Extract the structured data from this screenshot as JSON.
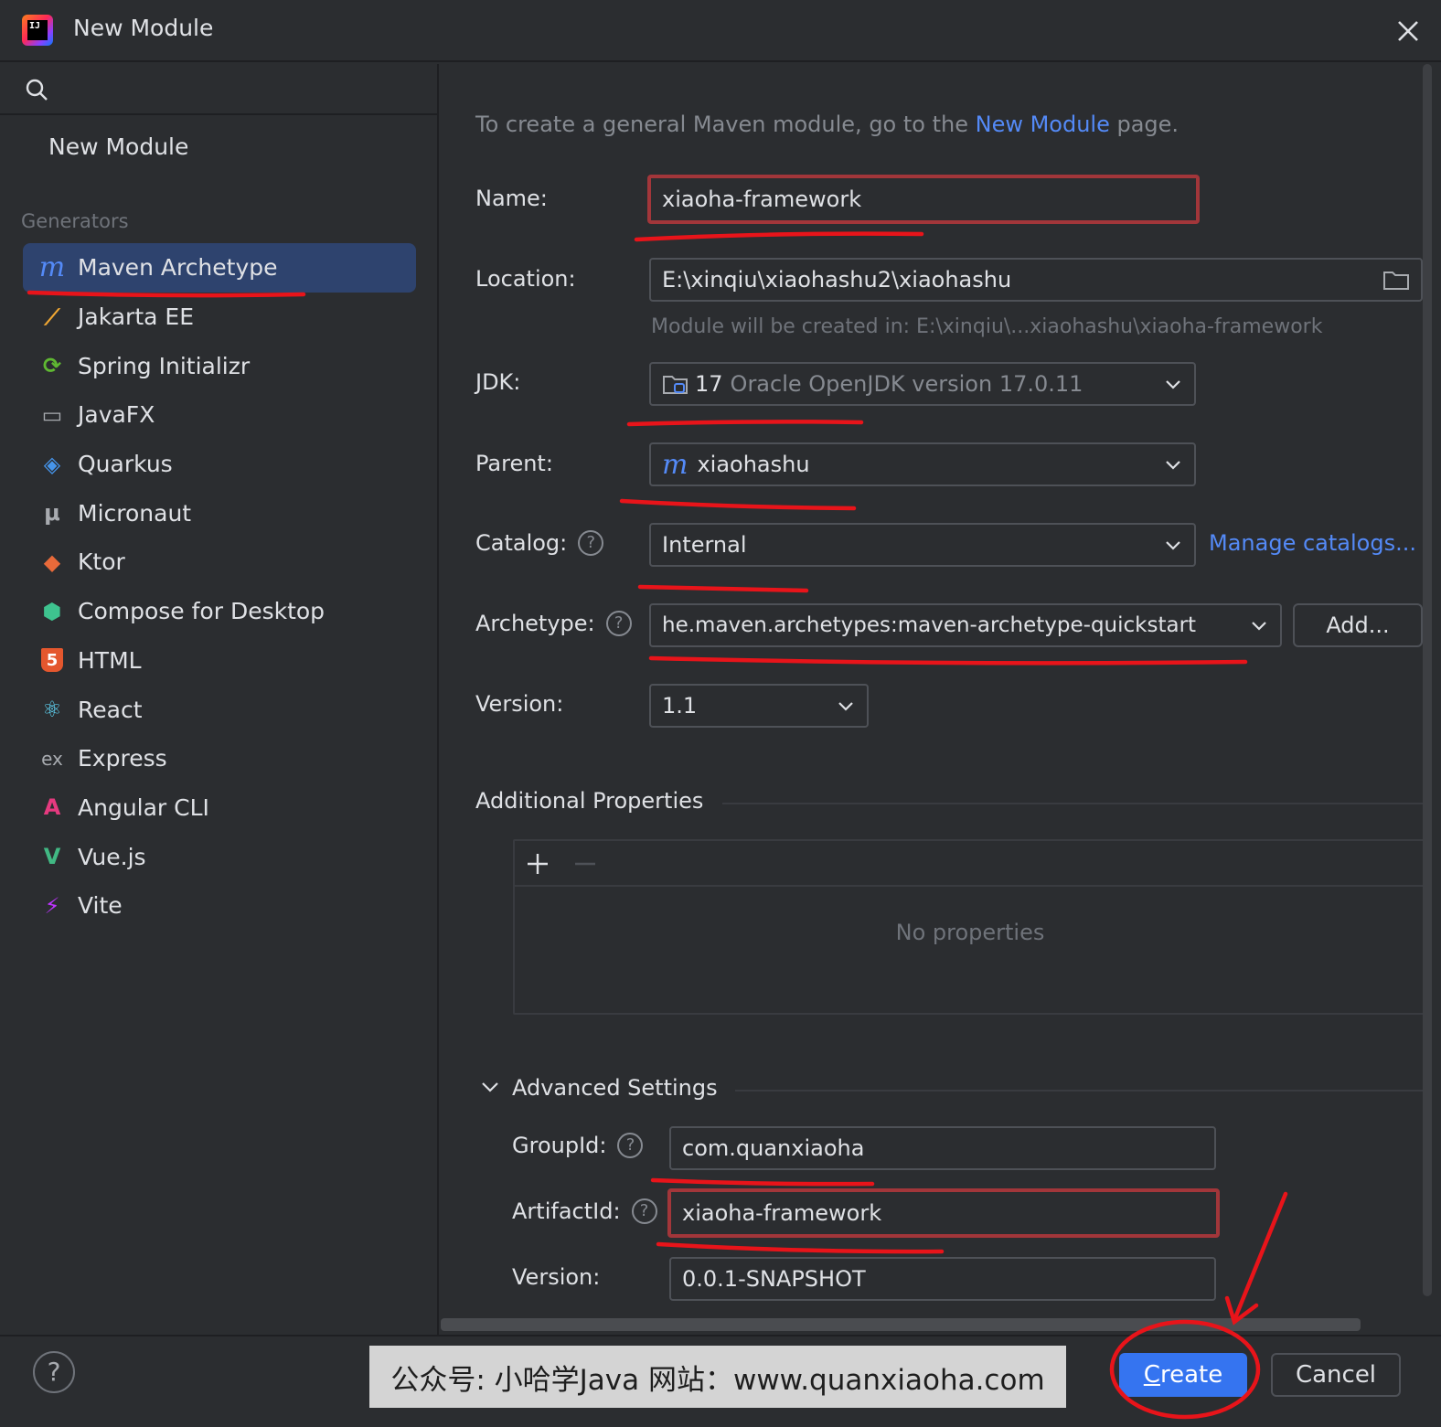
{
  "window": {
    "title": "New Module",
    "app_icon_text": "IJ"
  },
  "sidebar": {
    "new_module": "New Module",
    "generators_label": "Generators",
    "items": [
      {
        "label": "Maven Archetype",
        "icon": "maven-icon",
        "glyph": "m",
        "color": "#548af7",
        "selected": true
      },
      {
        "label": "Jakarta EE",
        "icon": "jakarta-ee-icon",
        "glyph": "⟋",
        "color": "#f0a733"
      },
      {
        "label": "Spring Initializr",
        "icon": "spring-icon",
        "glyph": "⟳",
        "color": "#5fb832"
      },
      {
        "label": "JavaFX",
        "icon": "javafx-icon",
        "glyph": "▭",
        "color": "#a8abb0"
      },
      {
        "label": "Quarkus",
        "icon": "quarkus-icon",
        "glyph": "◈",
        "color": "#4695eb"
      },
      {
        "label": "Micronaut",
        "icon": "micronaut-icon",
        "glyph": "μ",
        "color": "#a8abb0"
      },
      {
        "label": "Ktor",
        "icon": "ktor-icon",
        "glyph": "◆",
        "color": "#e86a3a"
      },
      {
        "label": "Compose for Desktop",
        "icon": "compose-icon",
        "glyph": "⬢",
        "color": "#3ec38f"
      },
      {
        "label": "HTML",
        "icon": "html-icon",
        "glyph": "5",
        "color": "#e4572e"
      },
      {
        "label": "React",
        "icon": "react-icon",
        "glyph": "⚛",
        "color": "#61dafb"
      },
      {
        "label": "Express",
        "icon": "express-icon",
        "glyph": "ex",
        "color": "#a8abb0"
      },
      {
        "label": "Angular CLI",
        "icon": "angular-icon",
        "glyph": "A",
        "color": "#e53a7f"
      },
      {
        "label": "Vue.js",
        "icon": "vue-icon",
        "glyph": "V",
        "color": "#41b883"
      },
      {
        "label": "Vite",
        "icon": "vite-icon",
        "glyph": "⚡",
        "color": "#bd34fe"
      }
    ]
  },
  "main": {
    "hint_prefix": "To create a general Maven module, go to the ",
    "hint_link": "New Module",
    "hint_suffix": " page.",
    "name_label": "Name:",
    "name_value": "xiaoha-framework",
    "location_label": "Location:",
    "location_value": "E:\\xinqiu\\xiaohashu2\\xiaohashu",
    "location_hint": "Module will be created in: E:\\xinqiu\\...xiaohashu\\xiaoha-framework",
    "jdk_label": "JDK:",
    "jdk_version": "17",
    "jdk_desc": "Oracle OpenJDK version 17.0.11",
    "parent_label": "Parent:",
    "parent_value": "xiaohashu",
    "catalog_label": "Catalog:",
    "catalog_value": "Internal",
    "manage_catalogs": "Manage catalogs...",
    "archetype_label": "Archetype:",
    "archetype_value": "he.maven.archetypes:maven-archetype-quickstart",
    "add_button": "Add...",
    "version_label": "Version:",
    "version_value": "1.1",
    "additional_properties": "Additional Properties",
    "no_properties": "No properties",
    "advanced_settings": "Advanced Settings",
    "groupid_label": "GroupId:",
    "groupid_value": "com.quanxiaoha",
    "artifactid_label": "ArtifactId:",
    "artifactid_value": "xiaoha-framework",
    "adv_version_label": "Version:",
    "adv_version_value": "0.0.1-SNAPSHOT"
  },
  "footer": {
    "help": "?",
    "watermark": "公众号: 小哈学Java  网站：www.quanxiaoha.com",
    "create_mnemonic": "C",
    "create_rest": "reate",
    "cancel": "Cancel"
  },
  "colors": {
    "accent": "#3574f0",
    "annotation": "#e8141a",
    "selection": "#2e436e"
  }
}
